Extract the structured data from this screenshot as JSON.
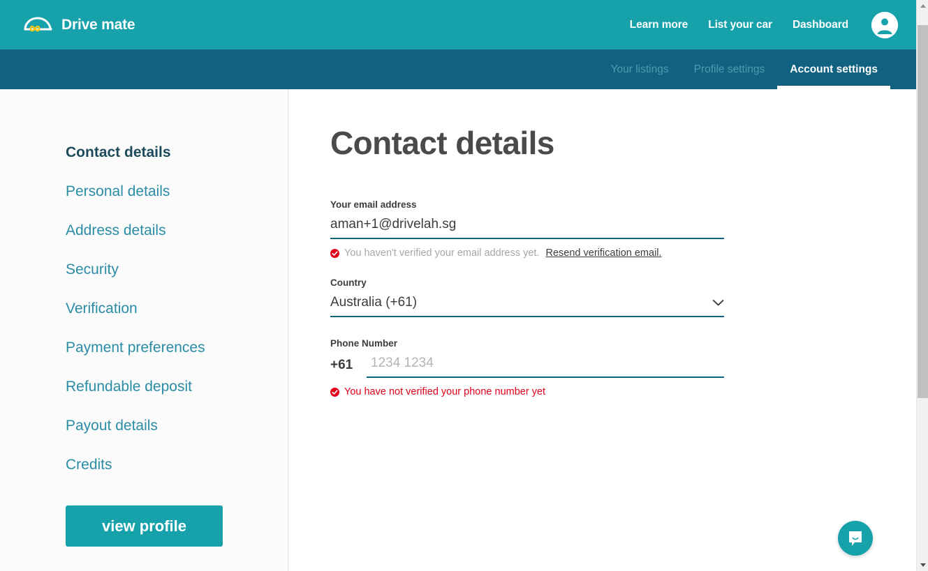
{
  "brand": {
    "name": "Drive mate",
    "logo_icon": "car-infinity-logo-icon",
    "logo_color": "#ffffff",
    "accent_color": "#f5c518"
  },
  "header": {
    "background_color": "#17a2ab",
    "links": [
      {
        "label": "Learn more",
        "name": "learn-more"
      },
      {
        "label": "List your car",
        "name": "list-your-car"
      },
      {
        "label": "Dashboard",
        "name": "dashboard"
      }
    ],
    "avatar_icon": "user-avatar-icon"
  },
  "subnav": {
    "background_color": "#116180",
    "items": [
      {
        "label": "Your listings",
        "active": false
      },
      {
        "label": "Profile settings",
        "active": false
      },
      {
        "label": "Account settings",
        "active": true
      }
    ]
  },
  "sidebar": {
    "items": [
      {
        "label": "Contact details",
        "active": true
      },
      {
        "label": "Personal details",
        "active": false
      },
      {
        "label": "Address details",
        "active": false
      },
      {
        "label": "Security",
        "active": false
      },
      {
        "label": "Verification",
        "active": false
      },
      {
        "label": "Payment preferences",
        "active": false
      },
      {
        "label": "Refundable deposit",
        "active": false
      },
      {
        "label": "Payout details",
        "active": false
      },
      {
        "label": "Credits",
        "active": false
      }
    ],
    "view_profile_label": "view profile"
  },
  "main": {
    "title": "Contact details",
    "email": {
      "label": "Your email address",
      "value": "aman+1@drivelah.sg",
      "placeholder": "Your email address",
      "hint_icon": "verified-check-icon",
      "hint_icon_color": "#e3001b",
      "hint_text": "You haven't verified your email address yet.",
      "hint_link": "Resend verification email."
    },
    "country": {
      "label": "Country",
      "value": "Australia (+61)",
      "chevron_icon": "chevron-down-icon"
    },
    "phone": {
      "label": "Phone Number",
      "prefix": "+61",
      "value": "",
      "placeholder": "1234 1234",
      "error_icon": "verified-check-icon",
      "error_icon_color": "#e3001b",
      "error_text": "You have not verified your phone number yet"
    }
  },
  "chat": {
    "icon": "chat-bubble-smile-icon",
    "color": "#17a2ab"
  },
  "scrollbar": {
    "up_arrow_icon": "scroll-up-arrow-icon",
    "down_arrow_icon": "scroll-down-arrow-icon"
  }
}
